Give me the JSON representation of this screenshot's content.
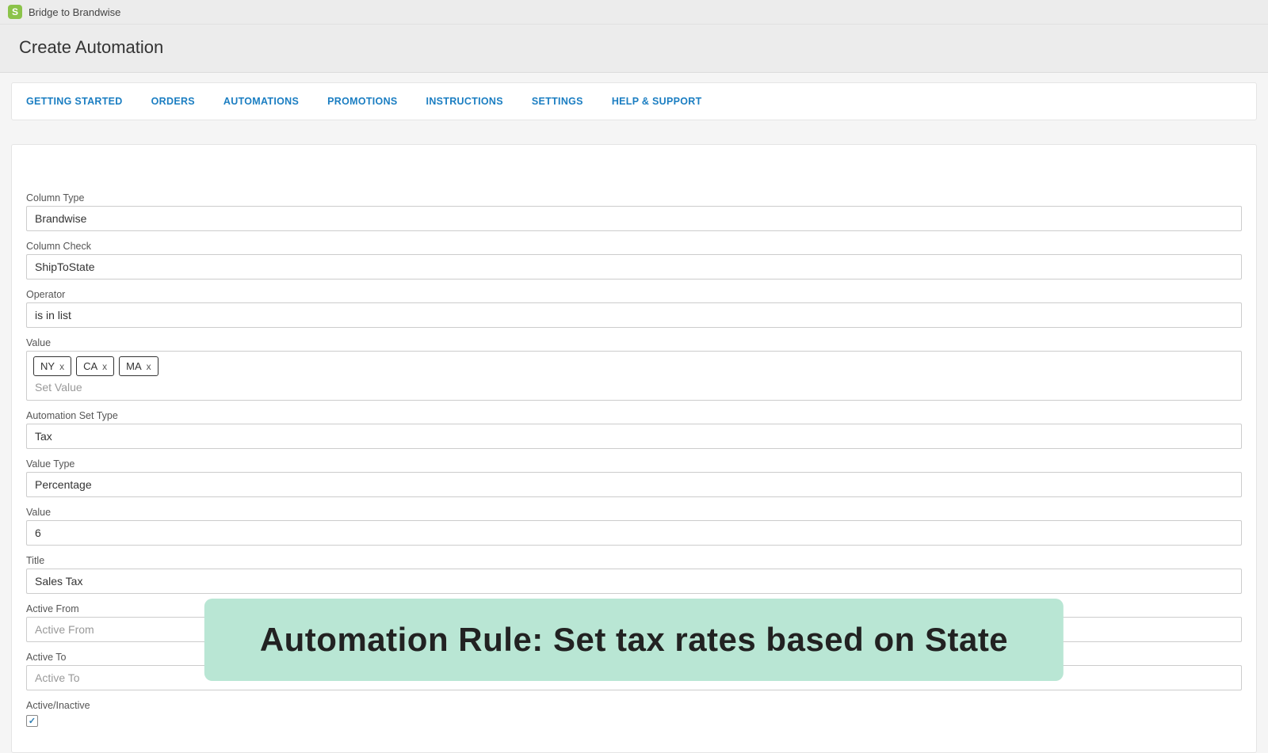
{
  "app": {
    "icon_letter": "S",
    "name": "Bridge to Brandwise"
  },
  "page": {
    "title": "Create Automation"
  },
  "tabs": [
    "GETTING STARTED",
    "ORDERS",
    "AUTOMATIONS",
    "PROMOTIONS",
    "INSTRUCTIONS",
    "SETTINGS",
    "HELP & SUPPORT"
  ],
  "form": {
    "column_type": {
      "label": "Column Type",
      "value": "Brandwise"
    },
    "column_check": {
      "label": "Column Check",
      "value": "ShipToState"
    },
    "operator": {
      "label": "Operator",
      "value": "is in list"
    },
    "value_list": {
      "label": "Value",
      "tags": [
        "NY",
        "CA",
        "MA"
      ],
      "placeholder": "Set Value"
    },
    "automation_set_type": {
      "label": "Automation Set Type",
      "value": "Tax"
    },
    "value_type": {
      "label": "Value Type",
      "value": "Percentage"
    },
    "value_number": {
      "label": "Value",
      "value": "6"
    },
    "title_field": {
      "label": "Title",
      "value": "Sales Tax"
    },
    "active_from": {
      "label": "Active From",
      "value": "",
      "placeholder": "Active From"
    },
    "active_to": {
      "label": "Active To",
      "value": "",
      "placeholder": "Active To"
    },
    "active_inactive": {
      "label": "Active/Inactive",
      "checked": true
    }
  },
  "banner": "Automation Rule: Set tax rates based on State"
}
